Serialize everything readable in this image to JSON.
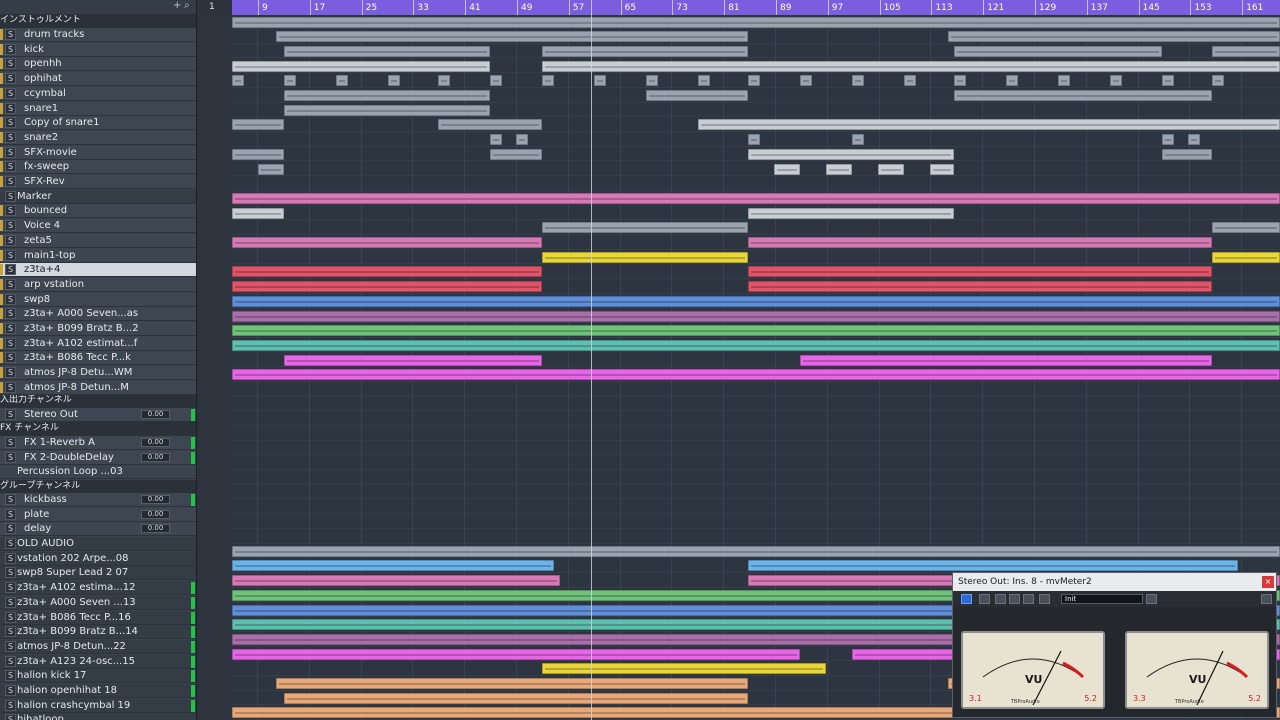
{
  "ruler": {
    "start": "1",
    "ticks": [
      "9",
      "17",
      "25",
      "33",
      "41",
      "49",
      "57",
      "65",
      "73",
      "81",
      "89",
      "97",
      "105",
      "113",
      "121",
      "129",
      "137",
      "145",
      "153",
      "161"
    ]
  },
  "tracklist": {
    "header": {
      "add_icon": "plus-icon",
      "search_icon": "search-icon"
    },
    "groups": {
      "instruments": "インストゥルメント",
      "io": "入出力チャンネル",
      "fx": "FX チャンネル",
      "group": "グループチャンネル"
    },
    "tracks": [
      {
        "name": "drum tracks",
        "kind": "folder-inst"
      },
      {
        "name": "kick",
        "kind": "inst"
      },
      {
        "name": "openhh",
        "kind": "inst"
      },
      {
        "name": "ophihat",
        "kind": "inst"
      },
      {
        "name": "ccymbal",
        "kind": "inst"
      },
      {
        "name": "snare1",
        "kind": "inst"
      },
      {
        "name": "Copy of snare1",
        "kind": "inst"
      },
      {
        "name": "snare2",
        "kind": "inst"
      },
      {
        "name": "SFX-movie",
        "kind": "inst"
      },
      {
        "name": "fx-sweep",
        "kind": "inst"
      },
      {
        "name": "SFX-Rev",
        "kind": "inst"
      },
      {
        "name": "Marker",
        "kind": "marker"
      },
      {
        "name": "bounced",
        "kind": "inst"
      },
      {
        "name": "Voice 4",
        "kind": "inst"
      },
      {
        "name": "zeta5",
        "kind": "inst"
      },
      {
        "name": "main1-top",
        "kind": "inst"
      },
      {
        "name": "z3ta+4",
        "kind": "inst-selected"
      },
      {
        "name": "arp vstation",
        "kind": "inst"
      },
      {
        "name": "swp8",
        "kind": "inst"
      },
      {
        "name": "z3ta+ A000 Seven...as",
        "kind": "inst"
      },
      {
        "name": "z3ta+ B099 Bratz B...2",
        "kind": "inst"
      },
      {
        "name": "z3ta+ A102 estimat...f",
        "kind": "inst"
      },
      {
        "name": "z3ta+ B086 Tecc P...k",
        "kind": "inst"
      },
      {
        "name": "atmos JP-8 Detu...WM",
        "kind": "inst"
      },
      {
        "name": "atmos JP-8 Detun...M",
        "kind": "inst"
      }
    ],
    "io_tracks": [
      {
        "name": "Stereo Out",
        "vol": "0.00"
      }
    ],
    "fx_tracks": [
      {
        "name": "FX 1-Reverb A",
        "vol": "0.00"
      },
      {
        "name": "FX 2-DoubleDelay",
        "vol": "0.00"
      }
    ],
    "percussion": "Percussion Loop ...03",
    "group_tracks": [
      {
        "name": "kickbass",
        "vol": "0.00"
      },
      {
        "name": "plate",
        "vol": "0.00"
      },
      {
        "name": "delay",
        "vol": "0.00"
      }
    ],
    "audio_tracks": [
      {
        "name": "OLD AUDIO"
      },
      {
        "name": "vstation 202 Arpe...08"
      },
      {
        "name": "swp8 Super Lead 2 07"
      },
      {
        "name": "z3ta+ A102 estima...12"
      },
      {
        "name": "z3ta+ A000 Seven ...13"
      },
      {
        "name": "z3ta+ B086 Tecc P...16"
      },
      {
        "name": "z3ta+ B099 Bratz B...14"
      },
      {
        "name": "atmos JP-8 Detun...22"
      },
      {
        "name": "z3ta+ A123 24-osc...15"
      },
      {
        "name": "halion kick 17"
      },
      {
        "name": "halion openhihat 18"
      },
      {
        "name": "halion crashcymbal 19"
      },
      {
        "name": "hihatloop"
      }
    ]
  },
  "plugin": {
    "title": "Stereo Out: Ins. 8 - mvMeter2",
    "close": "×",
    "preset": "Init",
    "left_value": "3.1",
    "left_right_value": "5.2",
    "right_value": "3.3",
    "right_right_value": "5.2",
    "vu_label": "VU",
    "brand": "TBProAudio"
  },
  "colors": {
    "ruler": "#7b5ee0",
    "grey_clip": "#9aa4b0",
    "light_clip": "#c8ced4",
    "pink_clip": "#d779b4",
    "red_clip": "#e0546a",
    "yellow_clip": "#e8d53a",
    "blue_clip": "#5f8fd8",
    "violet_clip": "#a96fa8",
    "green_clip": "#6fc27a",
    "teal_clip": "#5fbfae",
    "magenta_clip": "#e766e8",
    "skyblue_clip": "#6bb3e8",
    "orange_clip": "#e8a878"
  }
}
